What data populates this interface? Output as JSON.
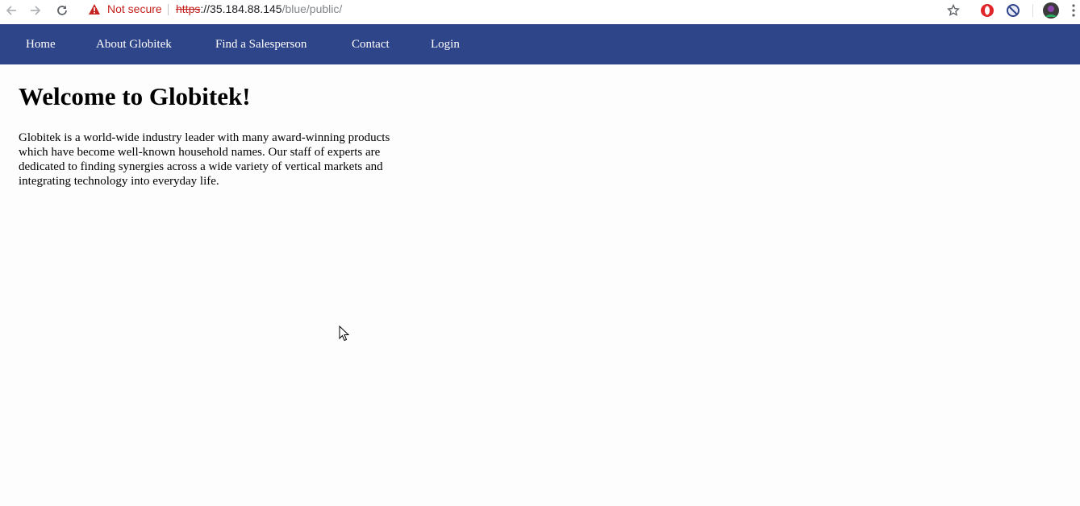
{
  "browser": {
    "security_label": "Not secure",
    "url_scheme": "https",
    "url_host": "://35.184.88.145",
    "url_path": "/blue/public/"
  },
  "nav": {
    "items": [
      {
        "label": "Home"
      },
      {
        "label": "About Globitek"
      },
      {
        "label": "Find a Salesperson"
      },
      {
        "label": "Contact"
      },
      {
        "label": "Login"
      }
    ],
    "background": "#2f4589"
  },
  "main": {
    "heading": "Welcome to Globitek!",
    "intro": "Globitek is a world-wide industry leader with many award-winning products which have become well-known household names. Our staff of experts are dedicated to finding synergies across a wide variety of vertical markets and integrating technology into everyday life."
  },
  "icons": {
    "back": "arrow-left-icon",
    "forward": "arrow-right-icon",
    "reload": "reload-icon",
    "warning": "warning-triangle-icon",
    "bookmark": "star-icon",
    "opera": "opera-icon",
    "block": "block-icon",
    "profile": "avatar",
    "menu": "kebab-menu-icon",
    "cursor": "mouse-cursor-icon"
  }
}
